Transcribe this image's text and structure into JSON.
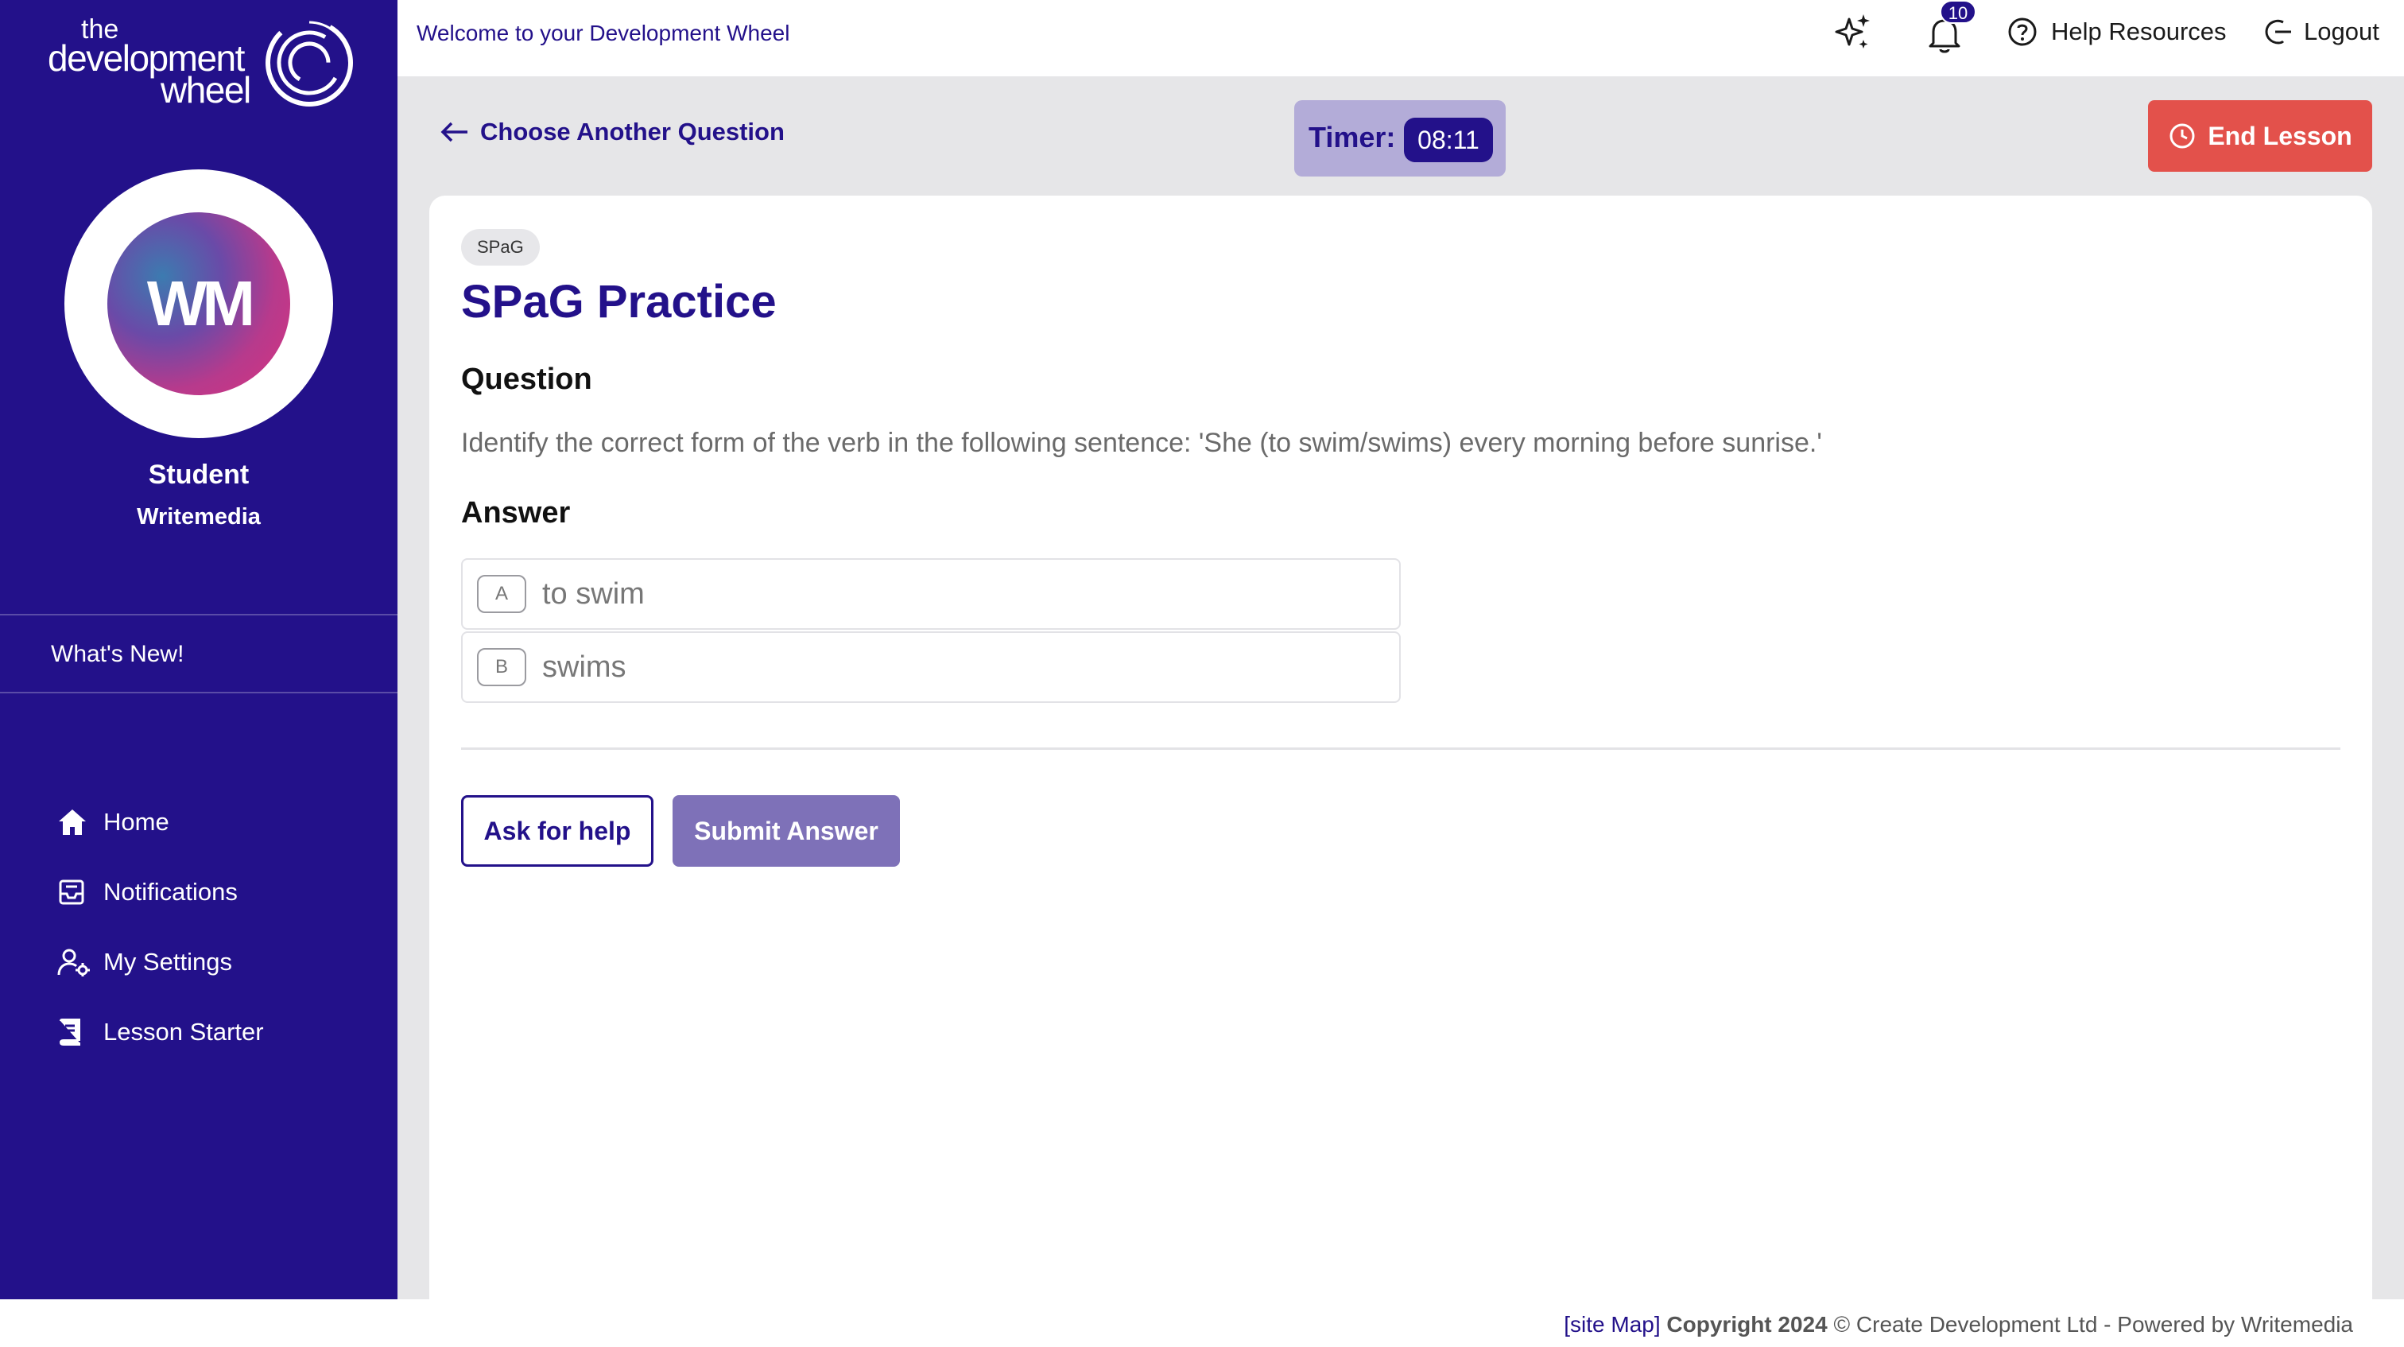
{
  "brand": {
    "logo_line1": "the",
    "logo_line2": "development",
    "logo_line3": "wheel",
    "primary_color": "#23118a",
    "danger_color": "#e3514b"
  },
  "sidebar": {
    "avatar_initials": "WM",
    "user_role": "Student",
    "user_org": "Writemedia",
    "whats_new": "What's New!",
    "nav": [
      {
        "label": "Home",
        "icon": "home-icon"
      },
      {
        "label": "Notifications",
        "icon": "inbox-icon"
      },
      {
        "label": "My Settings",
        "icon": "user-settings-icon"
      },
      {
        "label": "Lesson Starter",
        "icon": "book-icon"
      }
    ]
  },
  "topbar": {
    "welcome": "Welcome to your Development Wheel",
    "notification_count": "10",
    "help": "Help Resources",
    "logout": "Logout"
  },
  "lesson_bar": {
    "back": "Choose Another Question",
    "timer_label": "Timer:",
    "timer_value": "08:11",
    "end_lesson": "End Lesson"
  },
  "question_card": {
    "tag": "SPaG",
    "title": "SPaG Practice",
    "question_heading": "Question",
    "question_text": "Identify the correct form of the verb in the following sentence: 'She (to swim/swims) every morning before sunrise.'",
    "answer_heading": "Answer",
    "options": [
      {
        "letter": "A",
        "text": "to swim"
      },
      {
        "letter": "B",
        "text": "swims"
      }
    ],
    "ask_help": "Ask for help",
    "submit": "Submit Answer"
  },
  "footer": {
    "sitemap": "[site Map]",
    "copyright": "Copyright 2024",
    "rest": "© Create Development Ltd - Powered by Writemedia"
  }
}
